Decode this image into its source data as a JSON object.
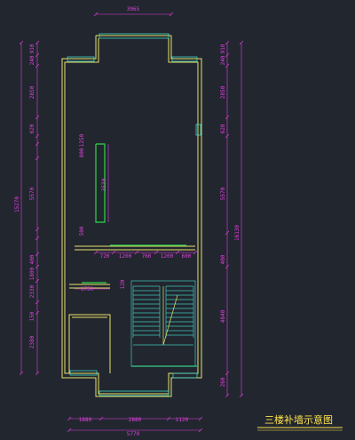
{
  "drawing": {
    "caption": "三楼补墙示意图",
    "colors": {
      "background": "#22262f",
      "wall": "#e8e36a",
      "dimension": "#e040e0",
      "new_wall": "#2fd84a",
      "window": "#3fd6c8",
      "stair": "#3fc8b8",
      "caption": "#ffe34d"
    },
    "dims": {
      "top_width": "3065",
      "left_outer": "15270",
      "left_segments": [
        "910",
        "240",
        "2850",
        "620",
        "1250",
        "800",
        "5570",
        "500",
        "400",
        "1800",
        "2330",
        "150",
        "2380"
      ],
      "right_outer": "16130",
      "right_segments": [
        "910",
        "240",
        "2850",
        "620",
        "5570",
        "400",
        "4840",
        "260"
      ],
      "inner_vertical": "3530",
      "inner_short": "120",
      "row_segments": [
        "720",
        "1200",
        "760",
        "1200",
        "600"
      ],
      "corridor": "1750",
      "bottom_segments": [
        "1880",
        "2880",
        "1120"
      ],
      "bottom_total": "5770"
    }
  }
}
